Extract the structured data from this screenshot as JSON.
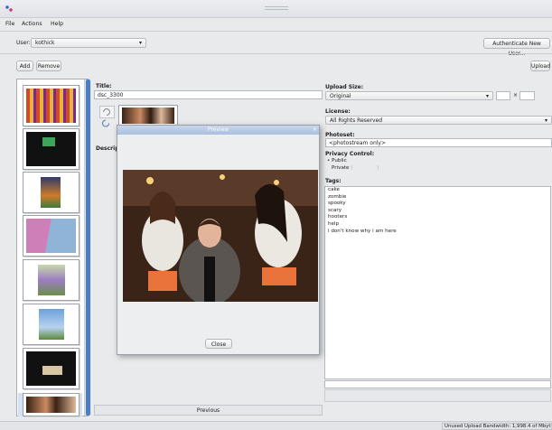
{
  "menu": {
    "file": "File",
    "actions": "Actions",
    "help": "Help"
  },
  "user": {
    "label": "User:",
    "value": "kothick",
    "auth_button": "Authenticate New User..."
  },
  "toolbar": {
    "add": "Add",
    "remove": "Remove",
    "upload": "Upload"
  },
  "thumbnails": {
    "count": 9,
    "selected_index": 8
  },
  "details": {
    "title_label": "Title:",
    "title_value": "dsc_3300",
    "description_label": "Descrip"
  },
  "upload_size": {
    "label": "Upload Size:",
    "value": "Original"
  },
  "license": {
    "label": "License:",
    "value": "All Rights Reserved"
  },
  "photoset": {
    "label": "Photoset:",
    "value": "<photostream only>"
  },
  "privacy": {
    "label": "Privacy Control:",
    "public": "Public",
    "private": "Private"
  },
  "tags": {
    "label": "Tags:",
    "items": [
      "cake",
      "zombie",
      "spooky",
      "scary",
      "hooters",
      "help",
      "i don't know why i am here"
    ]
  },
  "preview": {
    "title": "Preview",
    "close_button": "Close"
  },
  "bottom": {
    "previous": "Previous"
  },
  "status": {
    "text": "Unused Upload Bandwidth: 1,998.4 of Mbyt"
  },
  "colors": {
    "accent": "#4a7ec4",
    "dialog_title": "#b4c7e3"
  }
}
